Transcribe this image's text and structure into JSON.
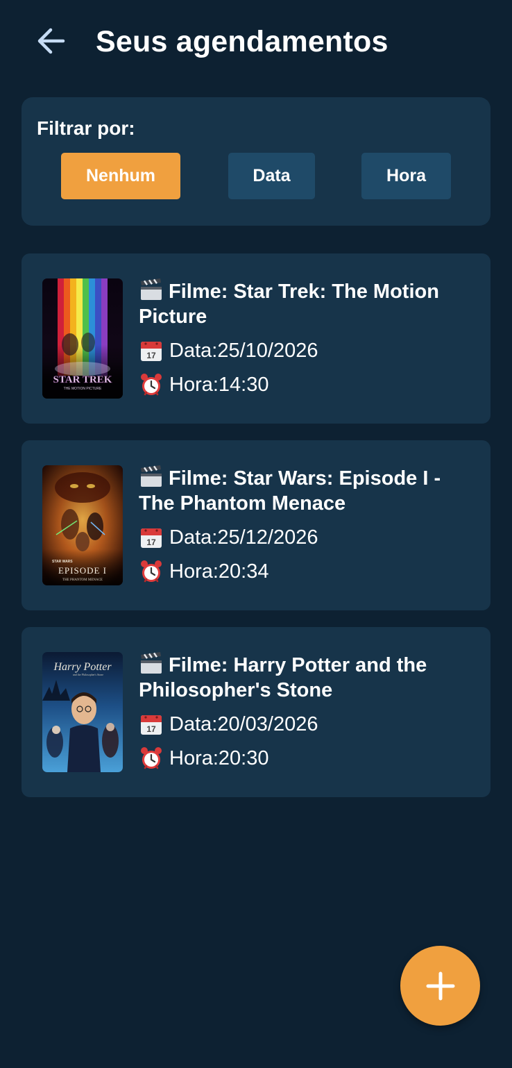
{
  "header": {
    "back_icon": "arrow-left-icon",
    "title": "Seus agendamentos"
  },
  "filter": {
    "label": "Filtrar por:",
    "options": [
      {
        "label": "Nenhum",
        "selected": true
      },
      {
        "label": "Data",
        "selected": false
      },
      {
        "label": "Hora",
        "selected": false
      }
    ]
  },
  "appointments": [
    {
      "movie_prefix": "Filme: ",
      "movie": "Star Trek: The Motion Picture",
      "date_prefix": "Data: ",
      "date": "25/10/2026",
      "time_prefix": "Hora: ",
      "time": "14:30",
      "poster_text": "STAR TREK",
      "poster_subtext": "THE MOTION PICTURE"
    },
    {
      "movie_prefix": "Filme: ",
      "movie": "Star Wars: Episode I - The Phantom Menace",
      "date_prefix": "Data: ",
      "date": "25/12/2026",
      "time_prefix": "Hora: ",
      "time": "20:34",
      "poster_text": "EPISODE I",
      "poster_subtext": "THE PHANTOM MENACE"
    },
    {
      "movie_prefix": "Filme: ",
      "movie": "Harry Potter and the Philosopher's Stone",
      "date_prefix": "Data: ",
      "date": "20/03/2026",
      "time_prefix": "Hora: ",
      "time": "20:30",
      "poster_text": "Harry Potter",
      "poster_subtext": "and the Philosopher's Stone"
    }
  ],
  "icons": {
    "movie": "clapper-board-icon",
    "date": "calendar-icon",
    "time": "alarm-clock-icon",
    "fab": "plus-icon"
  },
  "colors": {
    "background": "#0d2132",
    "card": "#17344a",
    "accent": "#f0a03f",
    "chip": "#1f4a68"
  }
}
